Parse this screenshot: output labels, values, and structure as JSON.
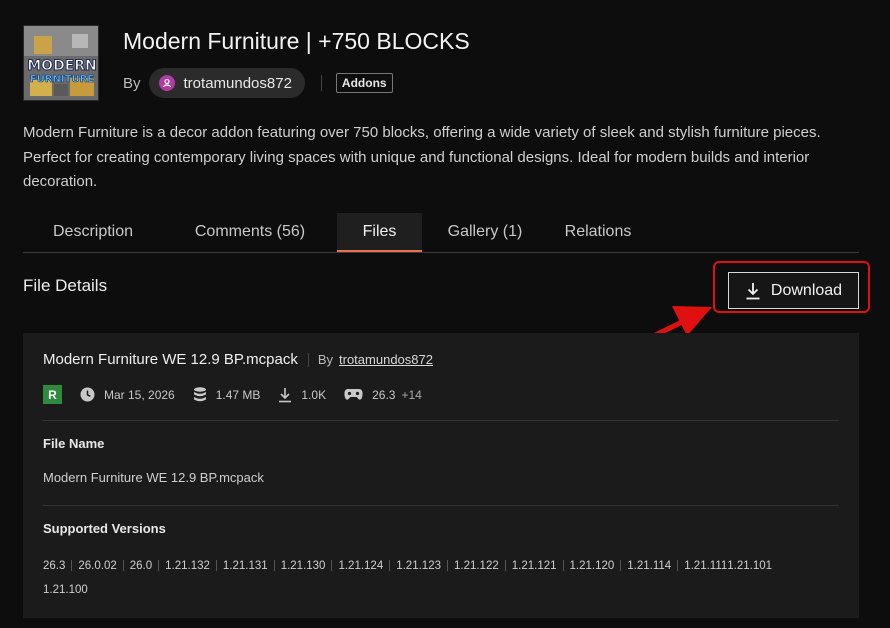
{
  "addon": {
    "title": "Modern Furniture | +750 BLOCKS",
    "by_label": "By",
    "author": "trotamundos872",
    "category": "Addons",
    "thumbnail_text": [
      "MODERN",
      "FURNITURE"
    ],
    "description": "Modern Furniture is a decor addon featuring over 750 blocks, offering a wide variety of sleek and stylish furniture pieces. Perfect for creating contemporary living spaces with unique and functional designs. Ideal for modern builds and interior decoration."
  },
  "tabs": [
    {
      "label": "Description",
      "active": false
    },
    {
      "label": "Comments (56)",
      "active": false
    },
    {
      "label": "Files",
      "active": true
    },
    {
      "label": "Gallery (1)",
      "active": false
    },
    {
      "label": "Relations",
      "active": false
    }
  ],
  "file_details": {
    "heading": "File Details",
    "download_label": "Download",
    "file_title": "Modern Furniture WE 12.9 BP.mcpack",
    "by_label": "By",
    "author": "trotamundos872",
    "release_badge": "R",
    "date": "Mar 15, 2026",
    "size": "1.47 MB",
    "downloads": "1.0K",
    "game_version": "26.3",
    "extra_versions": "+14",
    "file_name_label": "File Name",
    "file_name": "Modern Furniture WE 12.9 BP.mcpack",
    "supported_label": "Supported Versions",
    "supported_versions": [
      "26.3",
      "26.0.02",
      "26.0",
      "1.21.132",
      "1.21.131",
      "1.21.130",
      "1.21.124",
      "1.21.123",
      "1.21.122",
      "1.21.121",
      "1.21.120",
      "1.21.114",
      "1.21.111",
      "1.21.101",
      "1.21.100"
    ]
  },
  "icons": {
    "author": "user-icon",
    "date": "clock-icon",
    "size": "database-icon",
    "downloads": "download-icon",
    "game": "gamepad-icon"
  },
  "colors": {
    "accent_tab": "#e8734a",
    "highlight": "#e01010",
    "release_green": "#2e8b3e",
    "author_icon": "#b03aa6"
  }
}
